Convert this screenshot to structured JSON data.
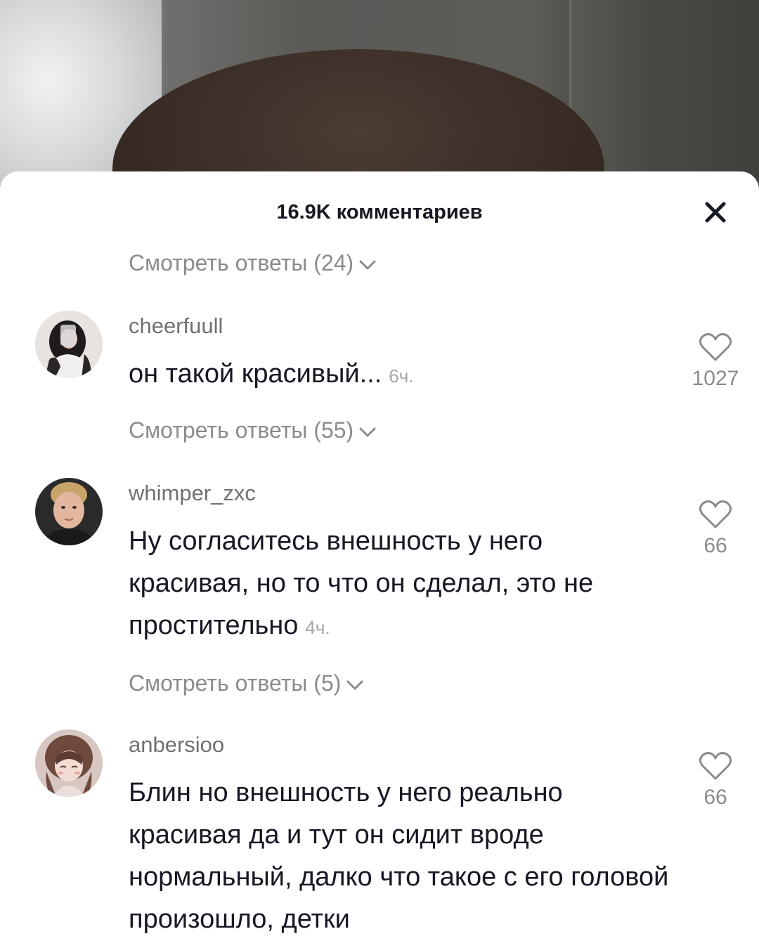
{
  "header": {
    "title": "16.9K комментариев",
    "close_label": "×"
  },
  "comments": [
    {
      "view_replies": "Смотреть ответы (24)",
      "username": "cheerfuull",
      "text": "он такой красивый...",
      "time": "6ч.",
      "likes": "1027",
      "avatar": "avatar-girl-dark-hair"
    },
    {
      "view_replies": "Смотреть ответы (55)",
      "username": "whimper_zxc",
      "text": "Ну согласитесь внешность у него красивая, но то что он сделал, это не простительно",
      "time": "4ч.",
      "likes": "66",
      "avatar": "avatar-man-photo"
    },
    {
      "view_replies": "Смотреть ответы (5)",
      "username": "anbersioo",
      "text": "Блин но внешность у него реально красивая да и тут он сидит вроде нормальный, далко что такое с его головой произошло, детки",
      "time": "",
      "likes": "66",
      "avatar": "avatar-anime-girl"
    }
  ],
  "colors": {
    "primary_text": "#161823",
    "secondary_text": "#8a8b91",
    "username": "#6f7076",
    "background": "#ffffff"
  },
  "icons": {
    "close": "close-icon",
    "chevron": "chevron-down-icon",
    "like": "heart-outline-icon"
  }
}
